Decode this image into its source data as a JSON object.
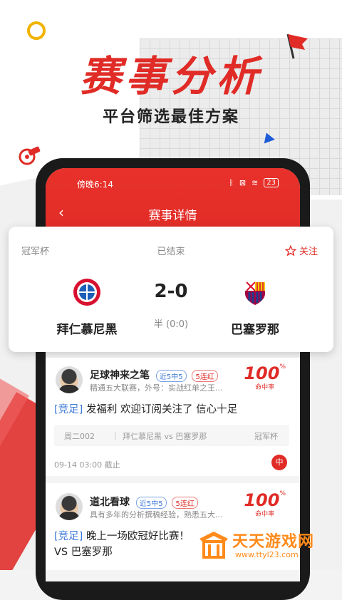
{
  "hero": {
    "title": "赛事分析",
    "subtitle": "平台筛选最佳方案"
  },
  "status_bar": {
    "time": "傍晚6:14",
    "battery": "23"
  },
  "nav": {
    "back": "‹",
    "title": "赛事详情"
  },
  "match": {
    "league": "冠军杯",
    "status": "已结束",
    "follow_label": "关注",
    "home_team": "拜仁慕尼黑",
    "away_team": "巴塞罗那",
    "score": "2-0",
    "half_time": "半 (0:0)"
  },
  "posts": [
    {
      "name": "足球神来之笔",
      "tag_recent": "近5中5",
      "tag_streak": "5连红",
      "desc": "精通五大联赛，外号：实战红单之王...",
      "rate": "100",
      "rate_unit": "%",
      "rate_label": "命中率",
      "kind": "[竞足]",
      "text": "发福利 欢迎订阅关注了 信心十足",
      "match_code": "周二002",
      "match_teams": "拜仁慕尼黑 vs 巴塞罗那",
      "match_league": "冠军杯",
      "deadline": "09-14 03:00 截止",
      "result": "中"
    },
    {
      "name": "道北看球",
      "tag_recent": "近5中5",
      "tag_streak": "5连红",
      "desc": "具有多年的分析撰稿经验，熟悉五大...",
      "rate": "100",
      "rate_unit": "%",
      "rate_label": "命中率",
      "kind": "[竞足]",
      "text": "晚上一场欧冠好比赛！",
      "text2": "VS 巴塞罗那"
    }
  ],
  "watermark": {
    "title": "天天游戏网",
    "url": "www.ttyl23.com"
  },
  "colors": {
    "accent": "#e02b26",
    "link_blue": "#3f7bd8",
    "watermark_orange": "#ff8a1a"
  }
}
